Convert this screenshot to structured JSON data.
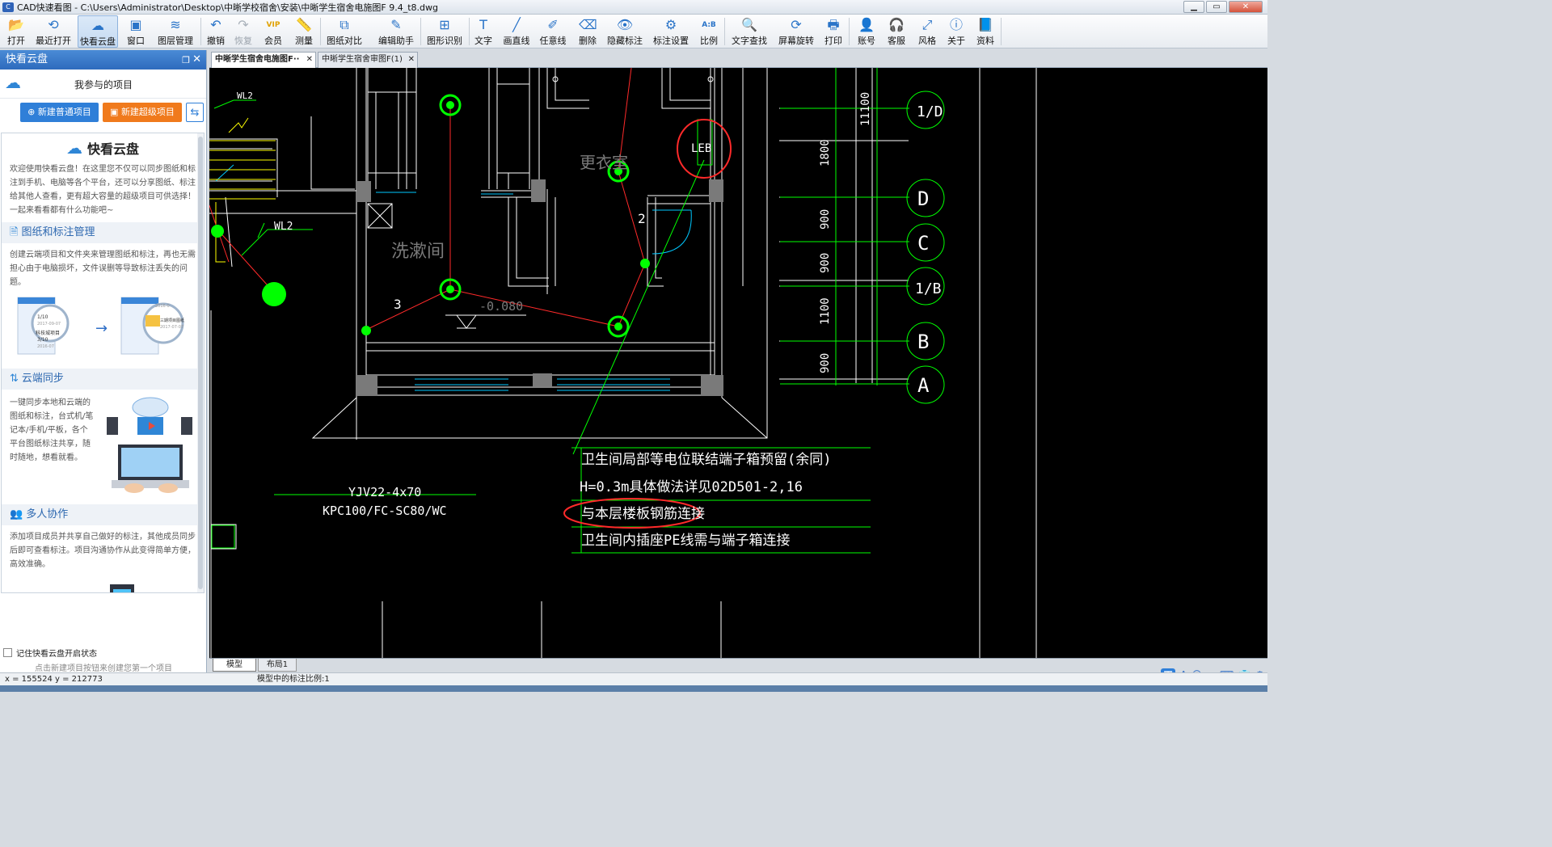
{
  "window": {
    "title": "CAD快速看图 - C:\\Users\\Administrator\\Desktop\\中晰学校宿舍\\安装\\中晰学生宿舍电施图F 9.4_t8.dwg",
    "minimize": "▁",
    "maximize": "▭",
    "close": "✕"
  },
  "toolbar": {
    "buttons": [
      {
        "label": "打开",
        "icon": "folder-open-icon",
        "glyph": "📂"
      },
      {
        "label": "最近打开",
        "icon": "history-icon",
        "glyph": "⟲"
      },
      {
        "label": "快看云盘",
        "icon": "cloud-icon",
        "glyph": "☁"
      },
      {
        "label": "窗口",
        "icon": "window-icon",
        "glyph": "▣"
      },
      {
        "label": "图层管理",
        "icon": "layers-icon",
        "glyph": "≋"
      },
      {
        "label": "撤销",
        "icon": "undo-icon",
        "glyph": "↶"
      },
      {
        "label": "恢复",
        "icon": "redo-icon",
        "glyph": "↷"
      },
      {
        "label": "会员",
        "icon": "vip-icon",
        "glyph": "VIP"
      },
      {
        "label": "测量",
        "icon": "ruler-icon",
        "glyph": "📏"
      },
      {
        "label": "图纸对比",
        "icon": "compare-icon",
        "glyph": "⧉"
      },
      {
        "label": "编辑助手",
        "icon": "edit-assistant-icon",
        "glyph": "✎"
      },
      {
        "label": "图形识别",
        "icon": "shape-recognize-icon",
        "glyph": "⊞"
      },
      {
        "label": "文字",
        "icon": "text-icon",
        "glyph": "T"
      },
      {
        "label": "画直线",
        "icon": "line-icon",
        "glyph": "╱"
      },
      {
        "label": "任意线",
        "icon": "freehand-icon",
        "glyph": "✐"
      },
      {
        "label": "删除",
        "icon": "eraser-icon",
        "glyph": "⌫"
      },
      {
        "label": "隐藏标注",
        "icon": "eye-hide-icon",
        "glyph": "👁"
      },
      {
        "label": "标注设置",
        "icon": "annotation-settings-icon",
        "glyph": "⚙"
      },
      {
        "label": "比例",
        "icon": "scale-icon",
        "glyph": "A:B"
      },
      {
        "label": "文字查找",
        "icon": "text-search-icon",
        "glyph": "🔍"
      },
      {
        "label": "屏幕旋转",
        "icon": "rotate-screen-icon",
        "glyph": "⟳"
      },
      {
        "label": "打印",
        "icon": "printer-icon",
        "glyph": "🖶"
      },
      {
        "label": "账号",
        "icon": "user-icon",
        "glyph": "👤"
      },
      {
        "label": "客服",
        "icon": "headset-icon",
        "glyph": "🎧"
      },
      {
        "label": "风格",
        "icon": "style-icon",
        "glyph": "⤢"
      },
      {
        "label": "关于",
        "icon": "info-icon",
        "glyph": "ⓘ"
      },
      {
        "label": "资料",
        "icon": "book-icon",
        "glyph": "📘"
      }
    ]
  },
  "sidebar": {
    "title": "快看云盘",
    "project_title": "我参与的项目",
    "new_normal": "新建普通项目",
    "new_super": "新建超级项目",
    "logo_text": "快看云盘",
    "welcome": "欢迎使用快看云盘！在这里您不仅可以同步图纸和标注到手机、电脑等各个平台，还可以分享图纸、标注给其他人查看，更有超大容量的超级项目可供选择！一起来看看都有什么功能吧~",
    "sections": [
      {
        "title": "图纸和标注管理",
        "text": "创建云端项目和文件夹来管理图纸和标注，再也无需担心由于电脑损坏，文件误删等导致标注丢失的问题。"
      },
      {
        "title": "云端同步",
        "text": "一键同步本地和云端的图纸和标注，台式机/笔记本/手机/平板，各个平台图纸标注共享，随时随地，想看就看。"
      },
      {
        "title": "多人协作",
        "text": "添加项目成员并共享自己做好的标注，其他成员同步后即可查看标注。项目沟通协作从此变得简单方便，高效准确。"
      }
    ],
    "illus1": {
      "card1_a": "1/10",
      "card1_b": "2017-09-07",
      "card1_c": "科技城项目",
      "card1_d": "3/10",
      "card1_e": "2016-07",
      "card2_a": "2016-0",
      "card2_b": "三期项目图纸",
      "card2_c": "2017-07-07"
    },
    "remember_label": "记住快看云盘开启状态",
    "hint": "点击新建项目按钮来创建您第一个项目"
  },
  "tabs": [
    {
      "label": "中晰学生宿舍电施图F··",
      "active": true
    },
    {
      "label": "中晰学生宿舍审图F(1)",
      "active": false
    }
  ],
  "drawing": {
    "room_laundry": "洗漱间",
    "room_locker": "更衣室",
    "wl2_a": "WL2",
    "wl2_b": "WL2",
    "num_3": "3",
    "num_2": "2",
    "level": "-0.080",
    "leb": "LEB",
    "cable1": "YJV22-4x70",
    "cable2": "KPC100/FC-SC80/WC",
    "note1": "卫生间局部等电位联结端子箱预留(余同)",
    "note2": "H=0.3m具体做法详见02D501-2,16",
    "note3": "与本层楼板钢筋连接",
    "note4": "卫生间内插座PE线需与端子箱连接",
    "axes": [
      "1/D",
      "D",
      "C",
      "1/B",
      "B",
      "A"
    ],
    "dims": [
      "11100",
      "1800",
      "900",
      "900",
      "1100",
      "900"
    ]
  },
  "layout_tabs": [
    "模型",
    "布局1"
  ],
  "status": {
    "coords": "x = 155524  y = 212773",
    "scale": "模型中的标注比例:1"
  },
  "ime": [
    "王",
    "A",
    "☺",
    "✂",
    "⌨",
    "👕",
    "⚙"
  ],
  "colors": {
    "accent": "#2f7fd8",
    "orange": "#f07a1c",
    "cad_bg": "#000000",
    "cad_green": "#00ff00",
    "cad_red": "#ff2a2a",
    "cad_white": "#ffffff",
    "cad_yellow": "#ffff00",
    "cad_cyan": "#00c8ff"
  }
}
